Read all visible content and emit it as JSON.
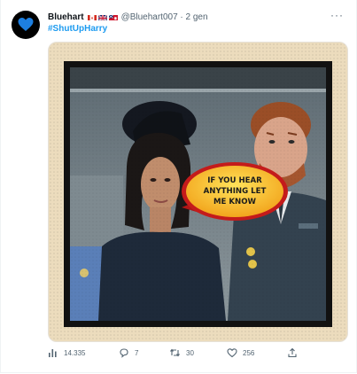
{
  "tweet": {
    "author_name": "Bluehart",
    "handle_time": "@Bluehart007 · 2 gen",
    "hashtag": "#ShutUpHarry",
    "more_label": "···",
    "speech_bubble": [
      "IF YOU HEAR",
      "ANYTHING LET",
      "ME KNOW"
    ],
    "stats": {
      "views": "14.335",
      "replies": "7",
      "retweets": "30",
      "likes": "256"
    }
  },
  "icons": [
    "blue-heart-icon",
    "canada-flag-icon",
    "uk-flag-icon",
    "bermuda-flag-icon",
    "more-icon",
    "views-icon",
    "reply-icon",
    "retweet-icon",
    "like-icon",
    "share-icon"
  ],
  "colors": {
    "link": "#1d9bf0",
    "muted": "#536471",
    "heart": "#1d7fe0"
  }
}
